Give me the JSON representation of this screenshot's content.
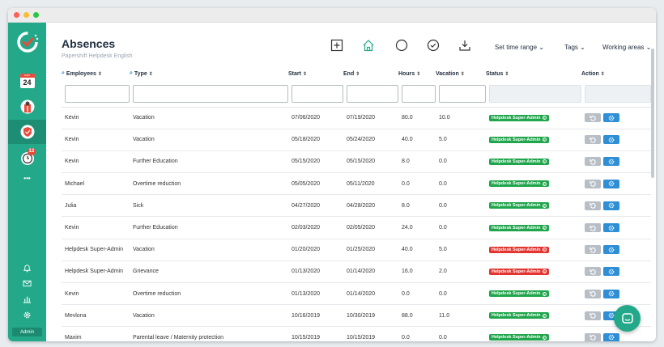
{
  "page": {
    "title": "Absences",
    "subtitle": "Papershift Helpdesk English"
  },
  "sidebar": {
    "calendar_day": "24",
    "calendar_month": "MAR",
    "timer_badge": "13",
    "more": "•••",
    "admin_label": "Admin"
  },
  "toolbar": {
    "dropdowns": [
      {
        "label": "Set time range"
      },
      {
        "label": "Tags"
      },
      {
        "label": "Working areas"
      }
    ]
  },
  "table": {
    "columns": [
      "Employees",
      "Type",
      "Start",
      "End",
      "Hours",
      "Vacation",
      "Status",
      "Action"
    ],
    "status_label": "Helpdesk Super-Admin",
    "rows": [
      {
        "employee": "Kevin",
        "type": "Vacation",
        "start": "07/06/2020",
        "end": "07/19/2020",
        "hours": "80.0",
        "vacation": "10.0",
        "status": "approved"
      },
      {
        "employee": "Kevin",
        "type": "Vacation",
        "start": "05/18/2020",
        "end": "05/24/2020",
        "hours": "40.0",
        "vacation": "5.0",
        "status": "approved"
      },
      {
        "employee": "Kevin",
        "type": "Further Education",
        "start": "05/15/2020",
        "end": "05/15/2020",
        "hours": "8.0",
        "vacation": "0.0",
        "status": "approved"
      },
      {
        "employee": "Michael",
        "type": "Overtime reduction",
        "start": "05/05/2020",
        "end": "05/11/2020",
        "hours": "0.0",
        "vacation": "0.0",
        "status": "approved"
      },
      {
        "employee": "Julia",
        "type": "Sick",
        "start": "04/27/2020",
        "end": "04/28/2020",
        "hours": "8.0",
        "vacation": "0.0",
        "status": "approved"
      },
      {
        "employee": "Kevin",
        "type": "Further Education",
        "start": "02/03/2020",
        "end": "02/05/2020",
        "hours": "24.0",
        "vacation": "0.0",
        "status": "approved"
      },
      {
        "employee": "Helpdesk Super-Admin",
        "type": "Vacation",
        "start": "01/20/2020",
        "end": "01/25/2020",
        "hours": "40.0",
        "vacation": "5.0",
        "status": "rejected"
      },
      {
        "employee": "Helpdesk Super-Admin",
        "type": "Grievance",
        "start": "01/13/2020",
        "end": "01/14/2020",
        "hours": "16.0",
        "vacation": "2.0",
        "status": "rejected"
      },
      {
        "employee": "Kevin",
        "type": "Overtime reduction",
        "start": "01/13/2020",
        "end": "01/14/2020",
        "hours": "0.0",
        "vacation": "0.0",
        "status": "approved"
      },
      {
        "employee": "Mevlona",
        "type": "Vacation",
        "start": "10/16/2019",
        "end": "10/30/2019",
        "hours": "88.0",
        "vacation": "11.0",
        "status": "approved"
      },
      {
        "employee": "Maxim",
        "type": "Parental leave / Maternity protection",
        "start": "10/15/2019",
        "end": "10/15/2019",
        "hours": "0.0",
        "vacation": "0.0",
        "status": "approved"
      }
    ]
  },
  "colors": {
    "brand": "#23a98a",
    "approved": "#1fa54b",
    "rejected": "#e3342f",
    "action_blue": "#2e8fd6"
  },
  "icons": [
    "logo-icon",
    "calendar-icon",
    "employee-icon",
    "shield-icon",
    "timer-icon",
    "bell-icon",
    "mail-icon",
    "chart-icon",
    "gear-icon",
    "plus-icon",
    "home-icon",
    "circle-icon",
    "check-icon",
    "download-icon",
    "chat-icon"
  ]
}
